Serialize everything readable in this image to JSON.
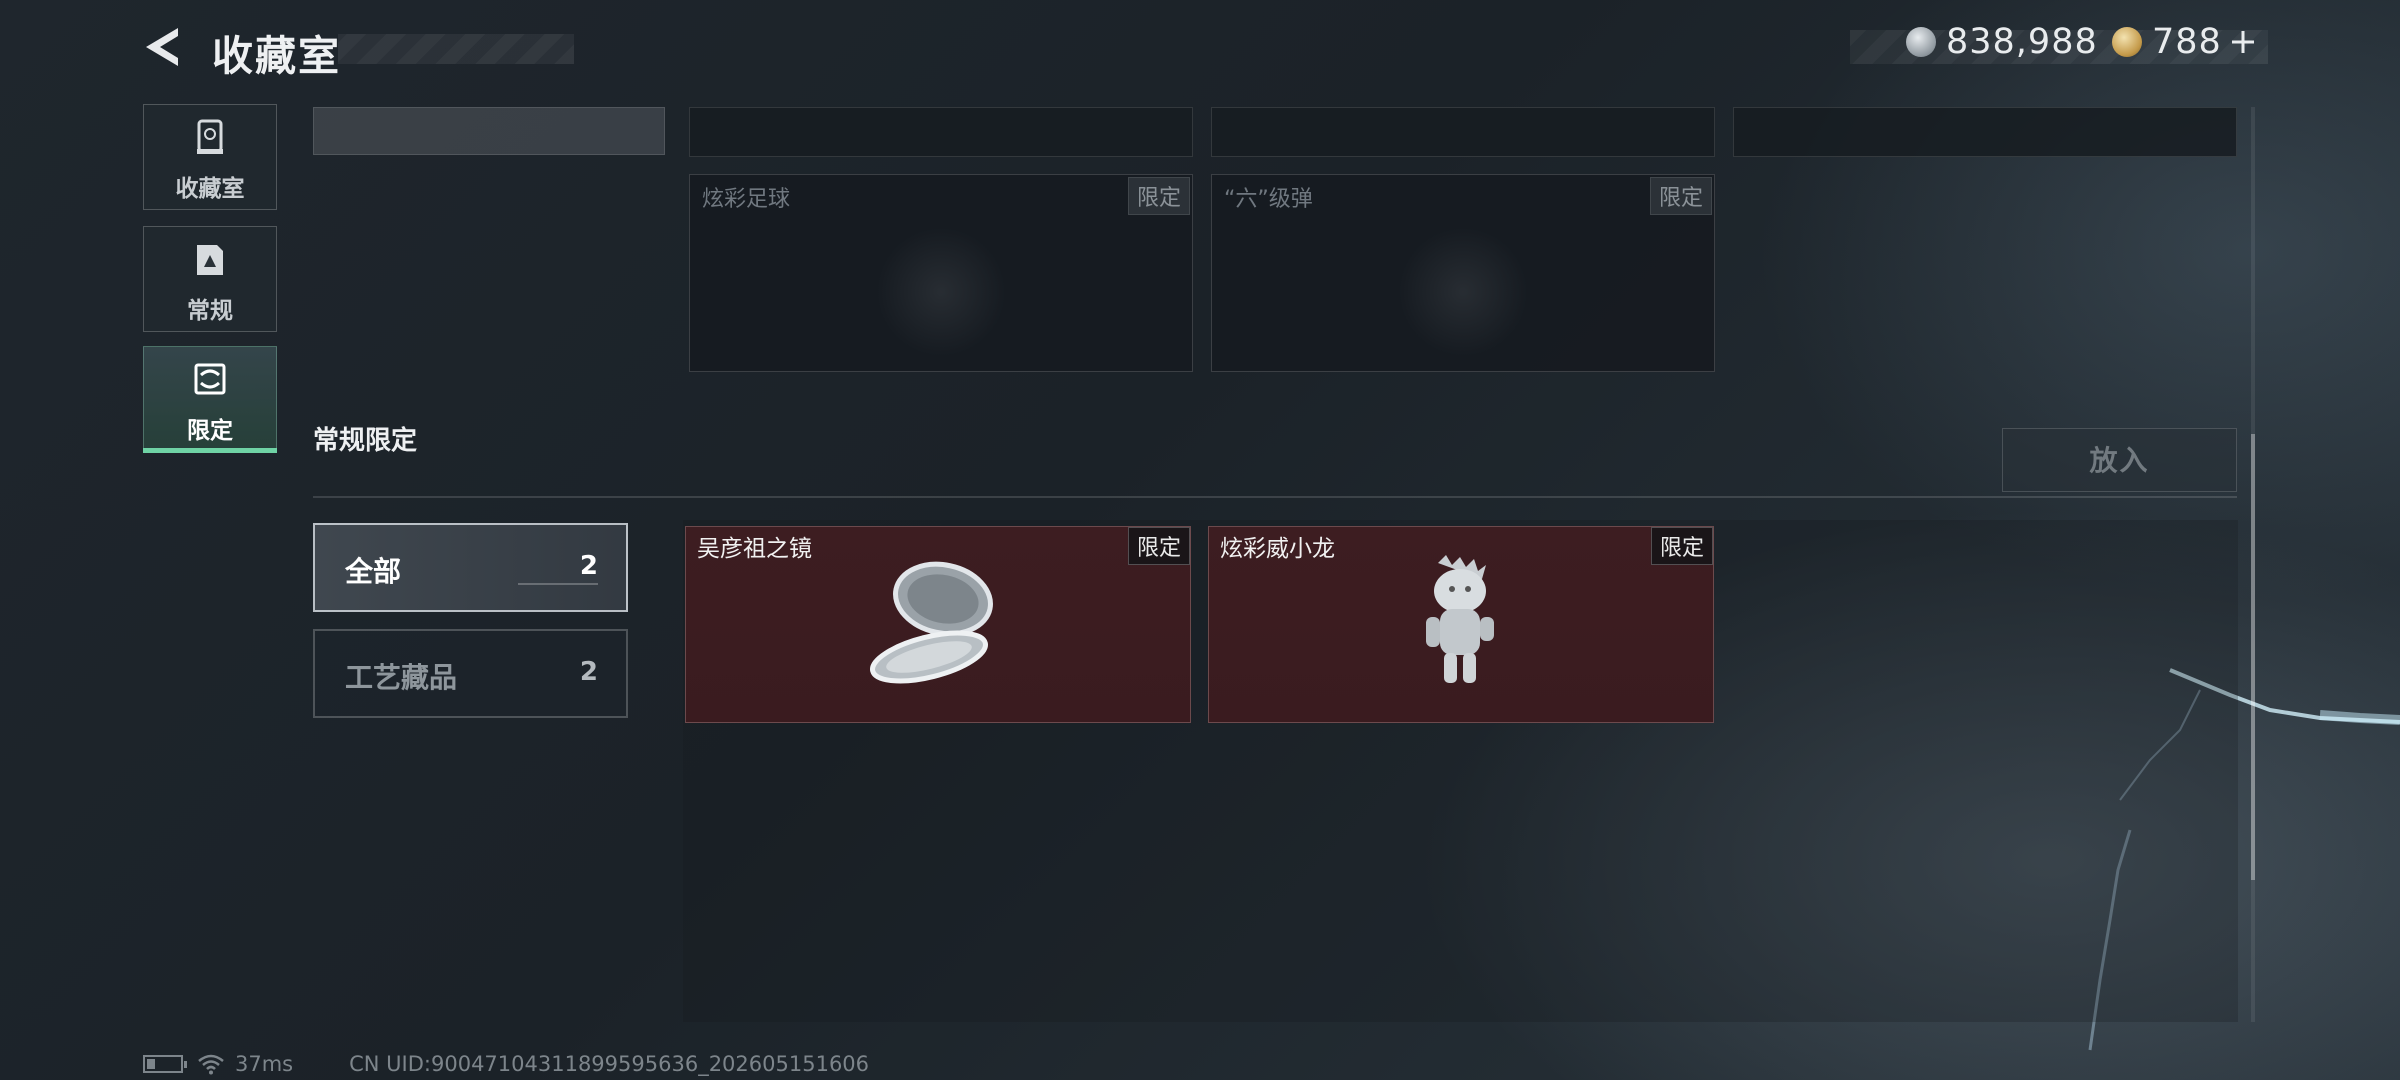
{
  "header": {
    "title": "收藏室",
    "currencies": [
      {
        "icon": "silver-coin-icon",
        "value": "838,988"
      },
      {
        "icon": "gold-coin-icon",
        "value": "788"
      }
    ]
  },
  "nav": {
    "tabs": [
      {
        "label": "收藏室",
        "icon": "display-case-icon"
      },
      {
        "label": "常规",
        "icon": "document-icon"
      },
      {
        "label": "限定",
        "icon": "limited-icon",
        "active": true
      }
    ]
  },
  "upper_cards": [
    {
      "name": "炫彩足球",
      "badge": "限定",
      "owned": false
    },
    {
      "name": "“六”级弹",
      "badge": "限定",
      "owned": false
    }
  ],
  "section": {
    "title": "常规限定",
    "place_button": "放入"
  },
  "filters": [
    {
      "label": "全部",
      "count": "2",
      "selected": true
    },
    {
      "label": "工艺藏品",
      "count": "2",
      "selected": false
    }
  ],
  "items": [
    {
      "name": "吴彦祖之镜",
      "badge": "限定",
      "icon": "compact-mirror-icon"
    },
    {
      "name": "炫彩威小龙",
      "badge": "限定",
      "icon": "dragon-figurine-icon"
    }
  ],
  "footer": {
    "ping": "37ms",
    "uid": "CN UID:9004710431189959​5636_202605151606"
  },
  "colors": {
    "accent": "#6fd3a5",
    "card_red": "#3d1d21"
  }
}
